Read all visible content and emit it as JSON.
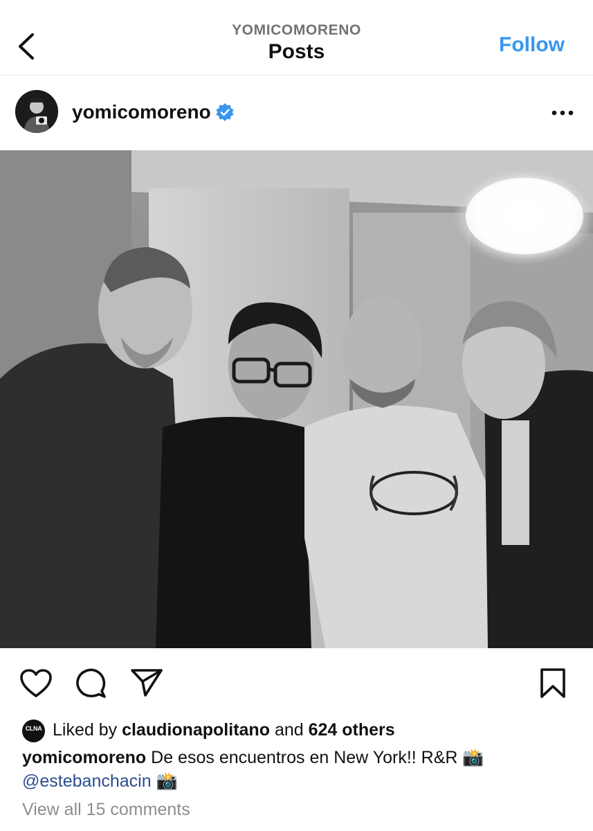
{
  "header": {
    "account": "YOMICOMORENO",
    "title": "Posts",
    "follow_label": "Follow"
  },
  "post": {
    "username": "yomicomoreno",
    "photo_alt": "Black and white photo of four people smiling together indoors under a chandelier",
    "liked_by_prefix": "Liked by",
    "liked_by_user": "claudionapolitano",
    "liked_by_and": "and",
    "liked_by_others": "624 others",
    "liker_avatar_text": "CLNA",
    "caption_username": "yomicomoreno",
    "caption_text": "De esos encuentros en New York!! R&R 📸",
    "caption_mention": "@estebanchacin",
    "caption_end_emoji": "📸",
    "comments_link": "View all 15 comments"
  },
  "icons": {
    "back": "chevron-left-icon",
    "verified": "verified-badge-icon",
    "more": "more-horizontal-icon",
    "like": "heart-icon",
    "comment": "comment-bubble-icon",
    "share": "paper-plane-icon",
    "save": "bookmark-icon"
  },
  "colors": {
    "follow": "#3897f0",
    "verified": "#3897f0",
    "mention": "#2a4d8f",
    "muted": "#8e8e8e"
  }
}
